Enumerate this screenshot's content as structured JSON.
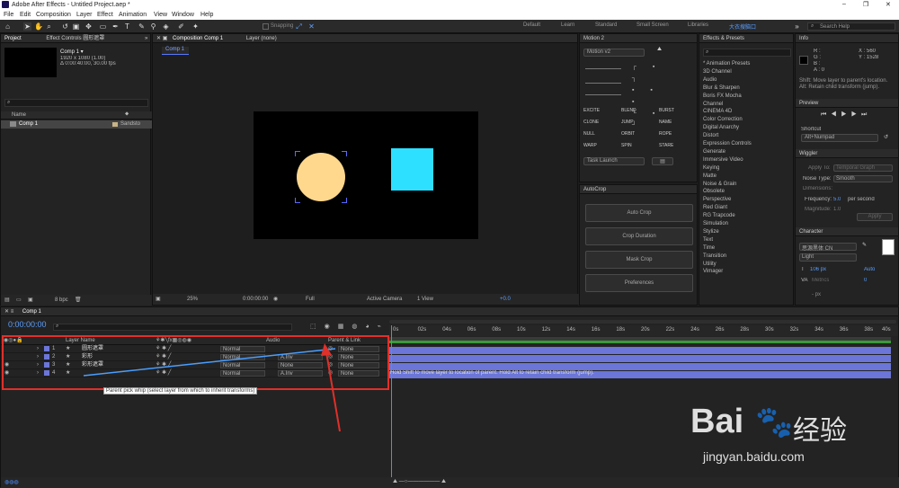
{
  "window": {
    "title": "Adobe After Effects - Untitled Project.aep *",
    "controls": [
      "–",
      "❐",
      "✕"
    ]
  },
  "menu": [
    "File",
    "Edit",
    "Composition",
    "Layer",
    "Effect",
    "Animation",
    "View",
    "Window",
    "Help"
  ],
  "toolbar": {
    "snapping": "Snapping",
    "workspaces": [
      "Default",
      "Learn",
      "Standard",
      "Small Screen",
      "Libraries"
    ],
    "active_workspace": "大衣搜脑口",
    "search_placeholder": "Search Help"
  },
  "project": {
    "tab": "Project",
    "effect_controls_tab": "Effect Controls 圆形遮罩",
    "comp_name": "Comp 1 ▾",
    "comp_res": "1920 x 1080 (1.00)",
    "comp_dur": "Δ 0:00:40:00, 30.00 fps",
    "col_name": "Name",
    "item": "Comp 1",
    "item_type": "Sandsto",
    "bpc": "8 bpc"
  },
  "comp": {
    "tab": "Composition Comp 1",
    "layer_tab": "Layer (none)",
    "breadcrumb": "Comp 1",
    "zoom": "25%",
    "time": "0:00:00:00",
    "quality": "Full",
    "camera": "Active Camera",
    "views": "1 View",
    "exposure": "+0.0"
  },
  "colors": {
    "circle": "#ffd88d",
    "square": "#2ee0ff",
    "accent": "#6b76d8",
    "marker": "#e0302a"
  },
  "motion2": {
    "title": "Motion 2",
    "version": "Motion v2",
    "buttons": [
      "EXCITE",
      "BLEND",
      "BURST",
      "CLONE",
      "JUMP",
      "NAME",
      "NULL",
      "ORBIT",
      "ROPE",
      "WARP",
      "SPIN",
      "STARE"
    ],
    "task": "Task Launch"
  },
  "autocrop": {
    "title": "AutoCrop",
    "buttons": [
      "Auto Crop",
      "Crop Duration",
      "Mask Crop",
      "Preferences"
    ]
  },
  "effects": {
    "title": "Effects & Presets",
    "search_placeholder": "",
    "items": [
      "* Animation Presets",
      "3D Channel",
      "Audio",
      "Blur & Sharpen",
      "Boris FX Mocha",
      "Channel",
      "CINEMA 4D",
      "Color Correction",
      "Digital Anarchy",
      "Distort",
      "Expression Controls",
      "Generate",
      "Immersive Video",
      "Keying",
      "Matte",
      "Noise & Grain",
      "Obsolete",
      "Perspective",
      "Red Giant",
      "RG Trapcode",
      "Simulation",
      "Stylize",
      "Text",
      "Time",
      "Transition",
      "Utility",
      "Vimager"
    ]
  },
  "info": {
    "title": "Info",
    "r": "R :",
    "g": "G :",
    "b": "B :",
    "a": "A : 0",
    "x": "X : 560",
    "y": "Y : 1528",
    "hint": "Shift: Move layer to parent's location. Alt: Retain child transform (jump)."
  },
  "preview": {
    "title": "Preview"
  },
  "shortcut": {
    "label": "Shortcut",
    "value": "Alt+Numpad"
  },
  "wiggler": {
    "title": "Wiggler",
    "apply_to": "Apply To:",
    "apply_val": "Temporal Graph",
    "noise": "Noise Type:",
    "noise_val": "Smooth",
    "dims": "Dimensions:",
    "freq": "Frequency:",
    "freq_val": "5.0",
    "freq_unit": "per second",
    "mag": "Magnitude:",
    "mag_val": "1.0",
    "apply": "Apply"
  },
  "character": {
    "title": "Character",
    "font": "思源黑体 CN",
    "style": "Light",
    "size": "106 px",
    "leading": "Auto",
    "tracking": "Metrics",
    "track_val": "0",
    "stroke": "- px"
  },
  "timeline": {
    "tab": "Comp 1",
    "time": "0:00:00:00",
    "search_placeholder": "",
    "cols": [
      "Layer Name",
      "Audio",
      "Parent & Link"
    ],
    "layers": [
      {
        "n": "1",
        "name": "圆形遮罩",
        "mode": "Normal",
        "mat": "",
        "parent": "None"
      },
      {
        "n": "2",
        "name": "彩形",
        "mode": "Normal",
        "mat": "A.Inv",
        "parent": "None"
      },
      {
        "n": "3",
        "name": "彩形遮罩",
        "mode": "Normal",
        "mat": "None",
        "parent": "None"
      },
      {
        "n": "4",
        "name": "",
        "mode": "Normal",
        "mat": "A.Inv",
        "parent": "None"
      }
    ],
    "pickwhip_tip": "Parent pick whip (select layer from which to inherit transforms)",
    "status": "Hold Shift to move layer to location of parent. Hold Alt to retain child transform (jump).",
    "ruler": [
      "0s",
      "02s",
      "04s",
      "06s",
      "08s",
      "10s",
      "12s",
      "14s",
      "16s",
      "18s",
      "20s",
      "22s",
      "24s",
      "26s",
      "28s",
      "30s",
      "32s",
      "34s",
      "36s",
      "38s",
      "40s"
    ]
  },
  "watermark": {
    "brand": "Bai",
    "brand2": "经验",
    "url": "jingyan.baidu.com"
  }
}
